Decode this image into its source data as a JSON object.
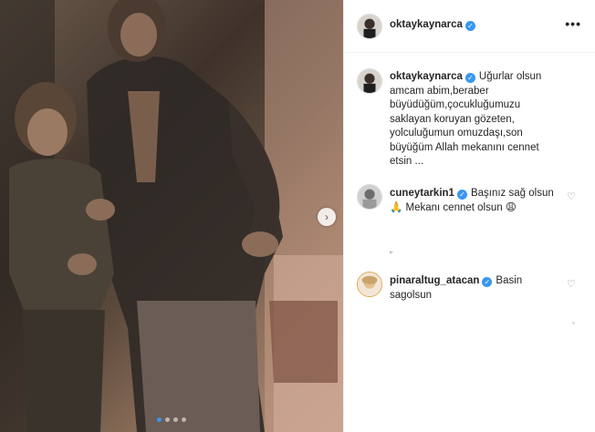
{
  "post": {
    "author": "oktaykaynarca",
    "more_icon": "more-horizontal-icon",
    "caption": "Uğurlar olsun amcam abim,beraber büyüdüğüm,çocukluğumuzu saklayan koruyan gözeten, yolculuğumun omuzdaşı,son büyüğüm Allah mekanını cennet etsin ...",
    "image_count": 4,
    "active_image": 1
  },
  "comments": [
    {
      "username": "cuneytarkin1",
      "verified": true,
      "text": "Başınız sağ olsun 🙏 Mekanı cennet olsun 😩"
    },
    {
      "username": "pinaraltug_atacan",
      "verified": true,
      "text": "Basin sagolsun"
    }
  ],
  "colors": {
    "verified_badge": "#3897f0",
    "divider": "#efefef",
    "text": "#262626"
  }
}
